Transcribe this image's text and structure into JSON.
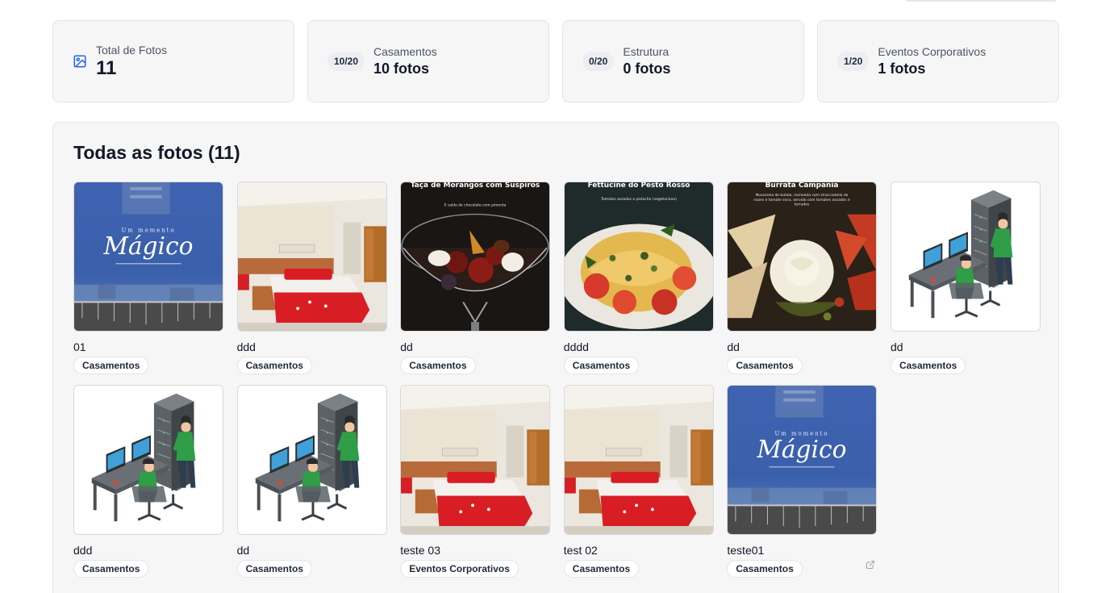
{
  "stats": [
    {
      "icon": "image-icon",
      "label": "Total de Fotos",
      "value": "11"
    },
    {
      "pill": "10/20",
      "label": "Casamentos",
      "value": "10 fotos"
    },
    {
      "pill": "0/20",
      "label": "Estrutura",
      "value": "0 fotos"
    },
    {
      "pill": "1/20",
      "label": "Eventos Corporativos",
      "value": "1 fotos"
    }
  ],
  "gallery": {
    "title": "Todas as fotos (11)",
    "photos": [
      {
        "title": "01",
        "category": "Casamentos",
        "image": "magico",
        "caption": "Um momento",
        "script": "Mágico"
      },
      {
        "title": "ddd",
        "category": "Casamentos",
        "image": "hotel-room"
      },
      {
        "title": "dd",
        "category": "Casamentos",
        "image": "dessert",
        "heading": "Taça de Morangos com Suspiros",
        "sub": "E calda de chocolate com pimenta"
      },
      {
        "title": "dddd",
        "category": "Casamentos",
        "image": "pasta",
        "heading": "Fettucine do Pesto Rosso",
        "sub": "Tomates assados e pistache (vegetariano)"
      },
      {
        "title": "dd",
        "category": "Casamentos",
        "image": "burrata",
        "heading": "Burrata Campania",
        "sub": "Mussarela de búfala, recheada com stracciatella de nozes e tomate seco, servido com tomates assados e torrados"
      },
      {
        "title": "dd",
        "category": "Casamentos",
        "image": "it-workers"
      },
      {
        "title": "ddd",
        "category": "Casamentos",
        "image": "it-workers"
      },
      {
        "title": "dd",
        "category": "Casamentos",
        "image": "it-workers"
      },
      {
        "title": "teste 03",
        "category": "Eventos Corporativos",
        "image": "hotel-room"
      },
      {
        "title": "test 02",
        "category": "Casamentos",
        "image": "hotel-room"
      },
      {
        "title": "teste01",
        "category": "Casamentos",
        "image": "magico",
        "caption": "Um momento",
        "script": "Mágico",
        "icon": "external-link-icon"
      }
    ]
  }
}
